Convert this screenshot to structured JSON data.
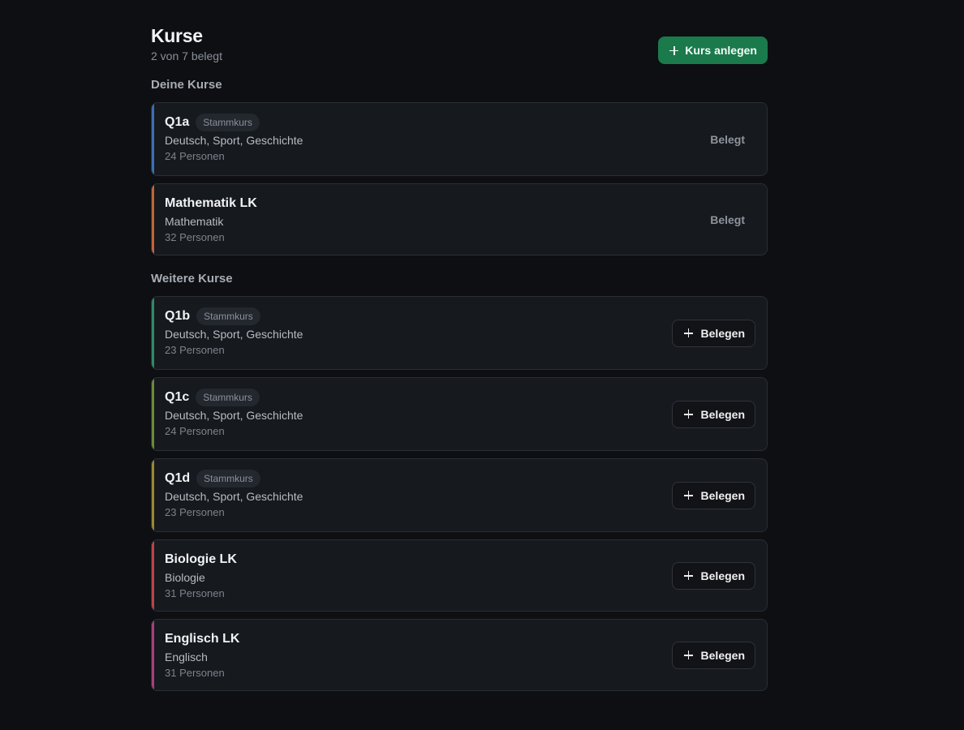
{
  "header": {
    "title": "Kurse",
    "subtitle": "2 von 7 belegt",
    "create_button_label": "Kurs anlegen",
    "create_button_color": "#1a7a4c"
  },
  "sections": {
    "mine_label": "Deine Kurse",
    "other_label": "Weitere Kurse"
  },
  "my_courses": [
    {
      "name": "Q1a",
      "badge": "Stammkurs",
      "subjects": "Deutsch, Sport, Geschichte",
      "persons": "24 Personen",
      "status": "Belegt",
      "accent": "#3b6fb6"
    },
    {
      "name": "Mathematik LK",
      "badge": "",
      "subjects": "Mathematik",
      "persons": "32 Personen",
      "status": "Belegt",
      "accent": "#c0653a"
    }
  ],
  "other_courses": [
    {
      "name": "Q1b",
      "badge": "Stammkurs",
      "subjects": "Deutsch, Sport, Geschichte",
      "persons": "23 Personen",
      "action": "Belegen",
      "accent": "#2f8a6a"
    },
    {
      "name": "Q1c",
      "badge": "Stammkurs",
      "subjects": "Deutsch, Sport, Geschichte",
      "persons": "24 Personen",
      "action": "Belegen",
      "accent": "#6a8a3a"
    },
    {
      "name": "Q1d",
      "badge": "Stammkurs",
      "subjects": "Deutsch, Sport, Geschichte",
      "persons": "23 Personen",
      "action": "Belegen",
      "accent": "#9a8a2e"
    },
    {
      "name": "Biologie LK",
      "badge": "",
      "subjects": "Biologie",
      "persons": "31 Personen",
      "action": "Belegen",
      "accent": "#b8454a"
    },
    {
      "name": "Englisch LK",
      "badge": "",
      "subjects": "Englisch",
      "persons": "31 Personen",
      "action": "Belegen",
      "accent": "#a8407a"
    }
  ]
}
